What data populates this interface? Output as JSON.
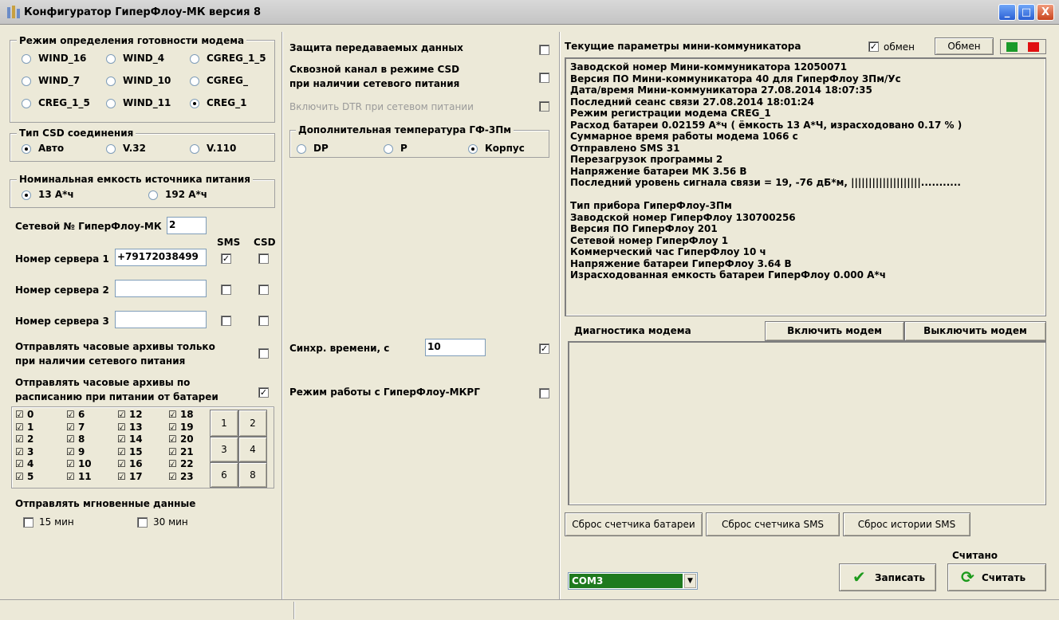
{
  "window": {
    "title": "Конфигуратор ГиперФлоу-МК версия 8",
    "min": "_",
    "max": "□",
    "close": "X"
  },
  "modem_mode": {
    "title": "Режим определения готовности модема",
    "options": [
      "WIND_16",
      "WIND_4",
      "CGREG_1_5",
      "WIND_7",
      "WIND_10",
      "CGREG_",
      "CREG_1_5",
      "WIND_11",
      "CREG_1"
    ],
    "selected": "CREG_1"
  },
  "csd_type": {
    "title": "Тип CSD соединения",
    "options": [
      "Авто",
      "V.32",
      "V.110"
    ],
    "selected": "Авто"
  },
  "capacity": {
    "title": "Номинальная емкость источника питания",
    "options": [
      "13 А*ч",
      "192 А*ч"
    ],
    "selected": "13 А*ч"
  },
  "network": {
    "label": "Сетевой № ГиперФлоу-МК",
    "value": "2"
  },
  "servers": {
    "sms_header": "SMS",
    "csd_header": "CSD",
    "rows": [
      {
        "label": "Номер сервера 1",
        "value": "+79172038499",
        "sms": true,
        "csd": false
      },
      {
        "label": "Номер сервера 2",
        "value": "",
        "sms": false,
        "csd": false
      },
      {
        "label": "Номер сервера 3",
        "value": "",
        "sms": false,
        "csd": false
      }
    ]
  },
  "hourly_mains": {
    "line1": "Отправлять часовые архивы только",
    "line2": "при наличии сетевого питания",
    "checked": false
  },
  "hourly_battery": {
    "line1": "Отправлять часовые архивы по",
    "line2": "расписанию при питании от батареи",
    "checked": true
  },
  "hours": [
    "0",
    "1",
    "2",
    "3",
    "4",
    "5",
    "6",
    "7",
    "8",
    "9",
    "10",
    "11",
    "12",
    "13",
    "14",
    "15",
    "16",
    "17",
    "18",
    "19",
    "20",
    "21",
    "22",
    "23"
  ],
  "hour_buttons": [
    "1",
    "2",
    "3",
    "4",
    "6",
    "8"
  ],
  "instant": {
    "title": "Отправлять мгновенные данные",
    "opt15": "15 мин",
    "opt30": "30 мин"
  },
  "middle": {
    "protect": "Защита передаваемых данных",
    "csd_line1": "Сквозной канал в режиме CSD",
    "csd_line2": "при наличии сетевого питания",
    "dtr": "Включить DTR при сетевом питании",
    "temp_title": "Дополнительная температура ГФ-3Пм",
    "temp_options": [
      "DP",
      "P",
      "Корпус"
    ],
    "temp_selected": "Корпус",
    "sync_label": "Синхр. времени, с",
    "sync_value": "10",
    "sync_checked": true,
    "mkrg_label": "Режим работы с ГиперФлоу-МКРГ",
    "mkrg_checked": false
  },
  "right": {
    "params_title": "Текущие параметры мини-коммуникатора",
    "exchange_check_label": "обмен",
    "exchange_checked": true,
    "exchange_button": "Обмен",
    "indicator_colors": [
      "#1a9a2a",
      "#e01010"
    ],
    "info_lines": [
      "Заводской номер Мини-коммуникатора  12050071",
      "Версия ПО Мини-коммуникатора  40 для ГиперФлоу 3Пм/Ус",
      "Дата/время Мини-коммуникатора  27.08.2014 18:07:35",
      "Последний сеанс связи  27.08.2014 18:01:24",
      "Режим регистрации модема  CREG_1",
      "Расход батареи  0.02159  А*ч  ( ёмкость 13 А*Ч, израсходовано 0.17 % )",
      "Суммарное время работы модема 1066 с",
      "Отправлено SMS 31",
      "Перезагрузок программы 2",
      "Напряжение батареи МК  3.56  В",
      "Последний уровень сигнала связи = 19, -76 дБ*м, ||||||||||||||||||||...........",
      "",
      "Тип прибора ГиперФлоу-3Пм",
      "Заводской номер ГиперФлоу  130700256",
      "Версия ПО ГиперФлоу  201",
      "Сетевой номер ГиперФлоу  1",
      "Коммерческий час ГиперФлоу  10  ч",
      "Напряжение батареи ГиперФлоу  3.64  В",
      "Израсходованная емкость батареи ГиперФлоу  0.000  А*ч"
    ],
    "diag_title": "Диагностика модема",
    "modem_on": "Включить модем",
    "modem_off": "Выключить модем",
    "reset_battery": "Сброс счетчика батареи",
    "reset_sms": "Сброс счетчика SMS",
    "reset_sms_history": "Сброс истории SMS",
    "port": "COM3",
    "status_read": "Считано",
    "write": "Записать",
    "read": "Считать"
  }
}
